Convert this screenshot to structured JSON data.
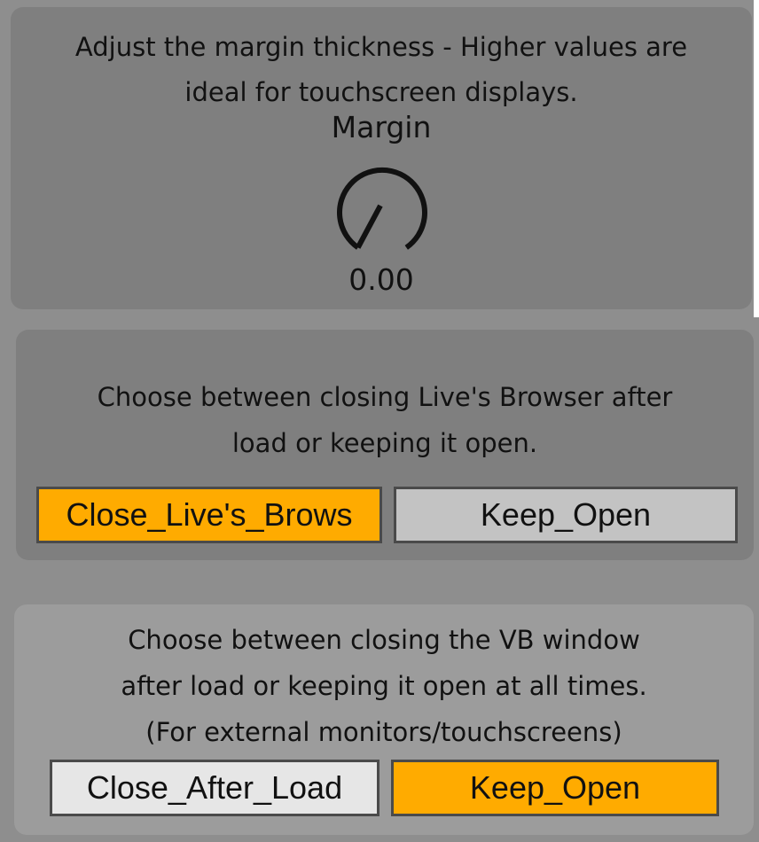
{
  "margin_section": {
    "description_line1": "Adjust the margin thickness - Higher values are",
    "description_line2": "ideal for touchscreen displays.",
    "knob_label": "Margin",
    "knob_value": "0.00"
  },
  "browser_section": {
    "description_line1": "Choose between closing Live's Browser after",
    "description_line2": "load or keeping it open.",
    "close_label": "Close_Live's_Brows",
    "keep_label": "Keep_Open",
    "selected": "close"
  },
  "vb_section": {
    "description_line1": "Choose between closing the VB window",
    "description_line2": "after load or keeping it open at all times.",
    "description_line3": "(For external monitors/touchscreens)",
    "close_label": "Close_After_Load",
    "keep_label": "Keep_Open",
    "selected": "keep"
  },
  "colors": {
    "active": "#ffab00",
    "inactive": "#c3c3c3",
    "panel": "#7f7f7f"
  }
}
